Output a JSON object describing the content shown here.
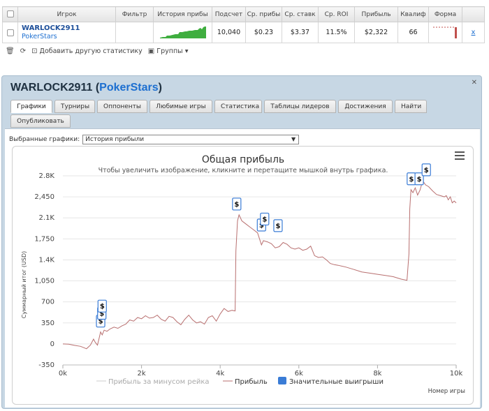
{
  "stats_table": {
    "columns": [
      "",
      "Игрок",
      "Фильтр",
      "История прибы",
      "Подсчет",
      "Ср. прибы",
      "Ср. ставк",
      "Ср. ROI",
      "Прибыль",
      "Квалиф",
      "Форма",
      ""
    ],
    "row": {
      "player_name": "WARLOCK2911",
      "player_site": "PokerStars",
      "filter": "",
      "count": "10,040",
      "avg_profit": "$0.23",
      "avg_stake": "$3.37",
      "avg_roi": "11.5%",
      "profit": "$2,322",
      "qualif": "66",
      "remove": "x"
    },
    "footer": {
      "add_stats": "Добавить другую статистику",
      "groups": "Группы"
    }
  },
  "panel": {
    "title_name": "WARLOCK2911",
    "title_open": "(",
    "title_site": "PokerStars",
    "title_close": ")",
    "close": "✕",
    "tabs": [
      "Графики",
      "Турниры",
      "Оппоненты",
      "Любимые игры",
      "Статистика",
      "Таблицы лидеров",
      "Достижения",
      "Найти",
      "Опубликовать"
    ],
    "active_tab": "Графики",
    "selected_label": "Выбранные графики:",
    "selected_value": "История прибыли"
  },
  "colors": {
    "profit_line": "#b86f6f",
    "rake_line": "#cccccc",
    "big_wins": "#3a7cd6",
    "sparkline": "#3fae3f",
    "form_bar": "#c0504d"
  },
  "chart_data": {
    "type": "line",
    "title": "Общая прибыль",
    "subtitle": "Чтобы увеличить изображение, кликните и перетащите мышкой внутрь графика.",
    "xlabel": "Номер игры",
    "ylabel": "Суммарный итог (USD)",
    "xlim": [
      0,
      10000
    ],
    "ylim": [
      -350,
      2800
    ],
    "x_ticks": [
      "0k",
      "2k",
      "4k",
      "6k",
      "8k",
      "10k"
    ],
    "y_ticks": [
      "-350",
      "0",
      "350",
      "700",
      "1,050",
      "1.4K",
      "1,750",
      "2.1K",
      "2,450",
      "2.8K"
    ],
    "legend": [
      "Прибыль за минусом рейка",
      "Прибыль",
      "Значительные выигрыши"
    ],
    "series": [
      {
        "name": "Прибыль",
        "points": [
          [
            0,
            0
          ],
          [
            150,
            -5
          ],
          [
            300,
            -25
          ],
          [
            450,
            -40
          ],
          [
            600,
            -80
          ],
          [
            700,
            -20
          ],
          [
            780,
            80
          ],
          [
            820,
            30
          ],
          [
            880,
            -20
          ],
          [
            920,
            90
          ],
          [
            960,
            200
          ],
          [
            1000,
            150
          ],
          [
            1050,
            230
          ],
          [
            1120,
            210
          ],
          [
            1200,
            250
          ],
          [
            1300,
            280
          ],
          [
            1400,
            260
          ],
          [
            1500,
            300
          ],
          [
            1600,
            330
          ],
          [
            1700,
            400
          ],
          [
            1800,
            380
          ],
          [
            1900,
            440
          ],
          [
            2000,
            420
          ],
          [
            2100,
            470
          ],
          [
            2200,
            430
          ],
          [
            2300,
            440
          ],
          [
            2400,
            480
          ],
          [
            2500,
            410
          ],
          [
            2600,
            380
          ],
          [
            2700,
            460
          ],
          [
            2800,
            440
          ],
          [
            2900,
            370
          ],
          [
            3000,
            320
          ],
          [
            3100,
            410
          ],
          [
            3200,
            480
          ],
          [
            3300,
            400
          ],
          [
            3400,
            350
          ],
          [
            3500,
            370
          ],
          [
            3600,
            330
          ],
          [
            3700,
            440
          ],
          [
            3800,
            470
          ],
          [
            3900,
            380
          ],
          [
            4000,
            500
          ],
          [
            4100,
            590
          ],
          [
            4200,
            540
          ],
          [
            4300,
            560
          ],
          [
            4380,
            550
          ],
          [
            4400,
            1550
          ],
          [
            4440,
            2050
          ],
          [
            4480,
            2150
          ],
          [
            4550,
            2050
          ],
          [
            4650,
            2000
          ],
          [
            4750,
            1950
          ],
          [
            4850,
            1900
          ],
          [
            4950,
            1850
          ],
          [
            5000,
            1750
          ],
          [
            5050,
            1650
          ],
          [
            5100,
            1720
          ],
          [
            5200,
            1700
          ],
          [
            5300,
            1670
          ],
          [
            5400,
            1600
          ],
          [
            5500,
            1620
          ],
          [
            5600,
            1690
          ],
          [
            5700,
            1660
          ],
          [
            5800,
            1600
          ],
          [
            5900,
            1580
          ],
          [
            6000,
            1600
          ],
          [
            6100,
            1560
          ],
          [
            6200,
            1580
          ],
          [
            6300,
            1630
          ],
          [
            6400,
            1470
          ],
          [
            6500,
            1440
          ],
          [
            6600,
            1450
          ],
          [
            6700,
            1400
          ],
          [
            6800,
            1340
          ],
          [
            6900,
            1320
          ],
          [
            7000,
            1310
          ],
          [
            7200,
            1280
          ],
          [
            7400,
            1240
          ],
          [
            7600,
            1200
          ],
          [
            7800,
            1180
          ],
          [
            8000,
            1160
          ],
          [
            8200,
            1140
          ],
          [
            8400,
            1120
          ],
          [
            8600,
            1080
          ],
          [
            8750,
            1060
          ],
          [
            8800,
            1500
          ],
          [
            8820,
            2250
          ],
          [
            8850,
            2570
          ],
          [
            8900,
            2520
          ],
          [
            8960,
            2600
          ],
          [
            9020,
            2480
          ],
          [
            9080,
            2560
          ],
          [
            9150,
            2720
          ],
          [
            9220,
            2650
          ],
          [
            9300,
            2620
          ],
          [
            9400,
            2550
          ],
          [
            9500,
            2490
          ],
          [
            9600,
            2470
          ],
          [
            9700,
            2450
          ],
          [
            9750,
            2470
          ],
          [
            9800,
            2400
          ],
          [
            9850,
            2450
          ],
          [
            9900,
            2350
          ],
          [
            9950,
            2380
          ],
          [
            10000,
            2350
          ]
        ]
      }
    ],
    "big_win_markers": [
      {
        "x": 960,
        "y": 200,
        "label": "$"
      },
      {
        "x": 990,
        "y": 330,
        "label": "$"
      },
      {
        "x": 1000,
        "y": 450,
        "label": "$"
      },
      {
        "x": 4420,
        "y": 2150,
        "label": "$"
      },
      {
        "x": 5050,
        "y": 1800,
        "label": "$"
      },
      {
        "x": 5130,
        "y": 1900,
        "label": "$"
      },
      {
        "x": 5470,
        "y": 1790,
        "label": "$"
      },
      {
        "x": 8860,
        "y": 2570,
        "label": "$"
      },
      {
        "x": 9060,
        "y": 2570,
        "label": "$"
      },
      {
        "x": 9240,
        "y": 2720,
        "label": "$"
      }
    ]
  }
}
